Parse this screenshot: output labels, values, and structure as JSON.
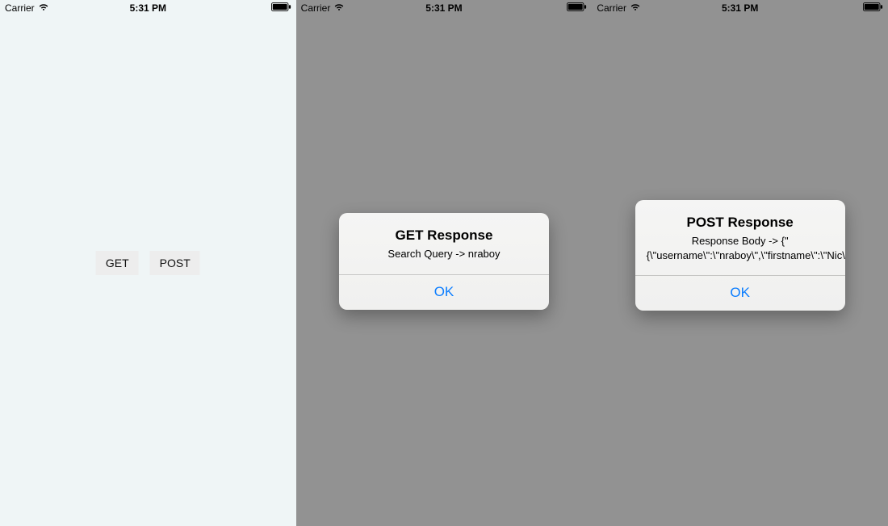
{
  "statusBar": {
    "carrier": "Carrier",
    "time": "5:31 PM"
  },
  "panel1": {
    "buttons": {
      "get": "GET",
      "post": "POST"
    }
  },
  "panel2": {
    "alert": {
      "title": "GET Response",
      "message": "Search Query -> nraboy",
      "ok": "OK"
    }
  },
  "panel3": {
    "alert": {
      "title": "POST Response",
      "message": "Response Body -> {\"{\\\"username\\\":\\\"nraboy\\\",\\\"firstname\\\":\\\"Nic\\\",\\\"lastname\\\":\\\"Raboy\\\"}\":\"\"}",
      "ok": "OK"
    }
  }
}
